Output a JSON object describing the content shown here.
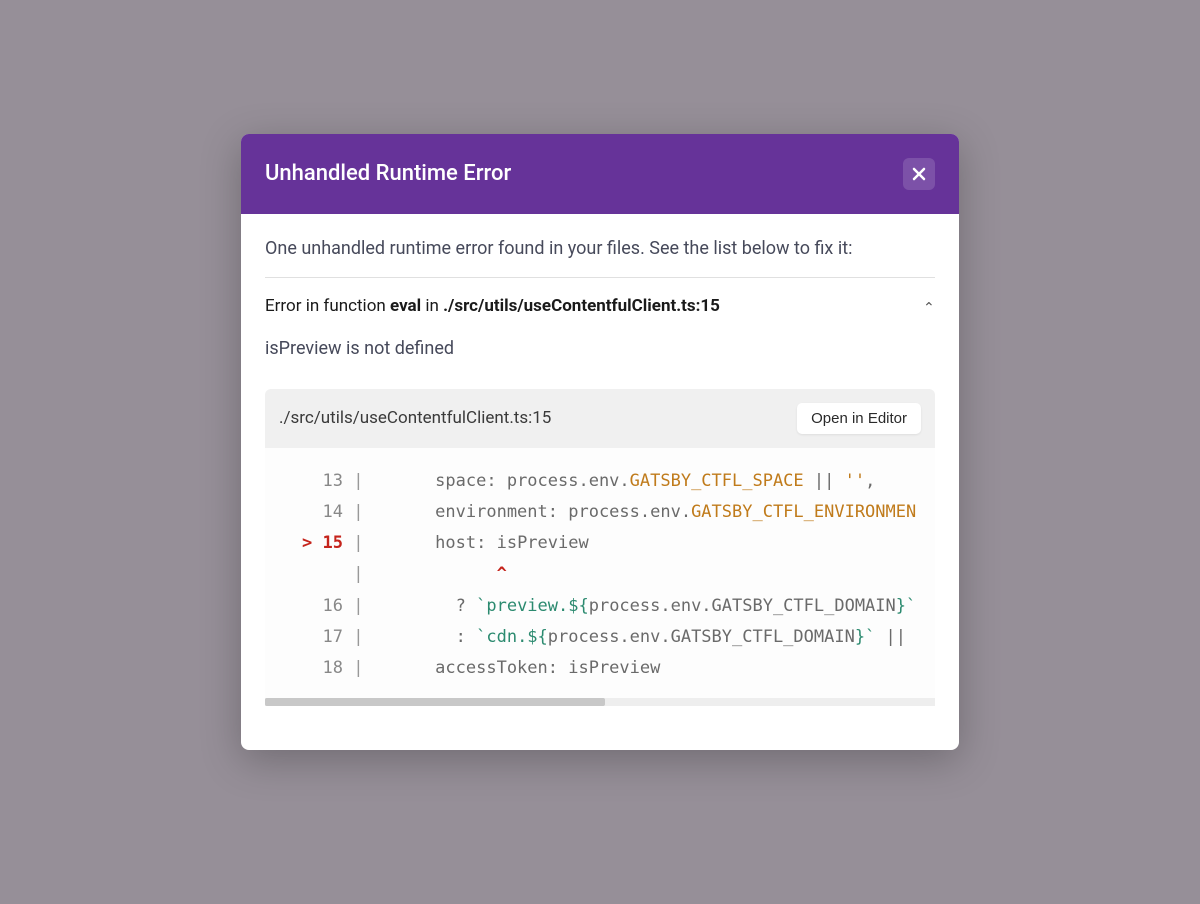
{
  "header": {
    "title": "Unhandled Runtime Error"
  },
  "description": "One unhandled runtime error found in your files. See the list below to fix it:",
  "error": {
    "prefix": "Error in function ",
    "fn": "eval",
    "in": " in ",
    "location": "./src/utils/useContentfulClient.ts:15",
    "message": "isPreview is not defined"
  },
  "fileBar": {
    "path": "./src/utils/useContentfulClient.ts:15",
    "openButton": "Open in Editor"
  },
  "code": {
    "lines": {
      "l13": {
        "num": "13",
        "indent": "      ",
        "k1": "space",
        "p1": ": process.env.",
        "c1": "GATSBY_CTFL_SPACE",
        "p2": " || ",
        "s1": "''",
        "p3": ","
      },
      "l14": {
        "num": "14",
        "indent": "      ",
        "k1": "environment",
        "p1": ": process.env.",
        "c1": "GATSBY_CTFL_ENVIRONMEN"
      },
      "l15": {
        "num": "15",
        "mark": "> ",
        "indent": "      ",
        "k1": "host",
        "p1": ": isPreview"
      },
      "caret": {
        "pad": "            ",
        "mark": "^"
      },
      "l16": {
        "num": "16",
        "indent": "        ",
        "p0": "? ",
        "t1": "`preview.${",
        "e1": "process.env.GATSBY_CTFL_DOMAIN",
        "t2": "}`"
      },
      "l17": {
        "num": "17",
        "indent": "        ",
        "p0": ": ",
        "t1": "`cdn.${",
        "e1": "process.env.GATSBY_CTFL_DOMAIN",
        "t2": "}`",
        "p2": " ||"
      },
      "l18": {
        "num": "18",
        "indent": "      ",
        "k1": "accessToken",
        "p1": ": isPreview"
      }
    }
  }
}
